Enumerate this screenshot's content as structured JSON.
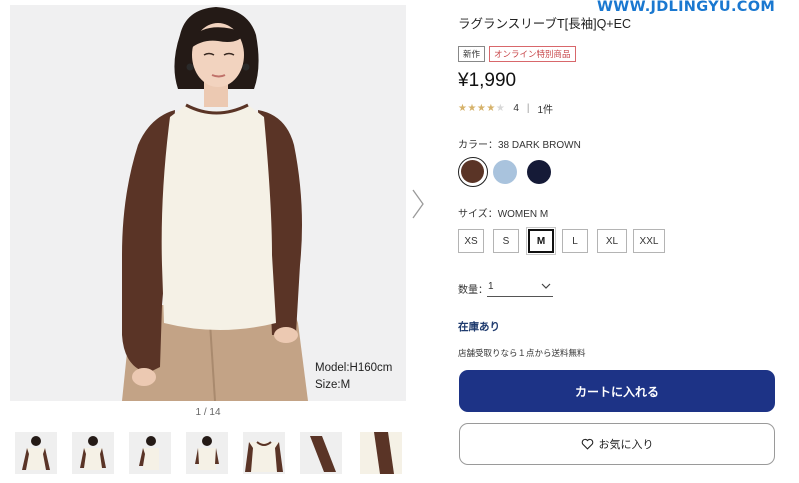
{
  "watermark": "WWW.JDLINGYU.COM",
  "gallery": {
    "model_height": "Model:H160cm",
    "model_size": "Size:M",
    "counter": "1 / 14",
    "next_icon": "chevron-right-icon",
    "thumbnail_count": 7
  },
  "product": {
    "title": "ラグランスリーブT[長袖]Q+EC",
    "badges": [
      "新作",
      "オンライン特別商品"
    ],
    "price": "¥1,990",
    "rating": {
      "stars": "★★★★",
      "empty_star": "★",
      "score_value": 4,
      "score": "4",
      "divider": "|",
      "count": "1件"
    }
  },
  "color": {
    "label": "カラー：38 DARK BROWN",
    "options": [
      {
        "name": "DARK BROWN",
        "hex": "#5a3426",
        "selected": true
      },
      {
        "name": "LIGHT BLUE",
        "hex": "#a9c3dd",
        "selected": false
      },
      {
        "name": "NAVY",
        "hex": "#151a37",
        "selected": false
      }
    ]
  },
  "size": {
    "label": "サイズ：WOMEN M",
    "options": [
      "XS",
      "S",
      "M",
      "L",
      "XL",
      "XXL"
    ],
    "selected": "M"
  },
  "quantity": {
    "label": "数量：",
    "value": "1",
    "icon": "chevron-down-icon"
  },
  "stock_status": "在庫あり",
  "shipping_note": "店舗受取りなら１点から送料無料",
  "buttons": {
    "cart": "カートに入れる",
    "favorite": "お気に入り",
    "favorite_icon": "heart-outline-icon"
  },
  "colors": {
    "cart_button": "#1d3386",
    "stock_text": "#1f3b6e",
    "watermark": "#1a78d0",
    "badge_red": "#c74548",
    "star": "#d6b26a"
  }
}
